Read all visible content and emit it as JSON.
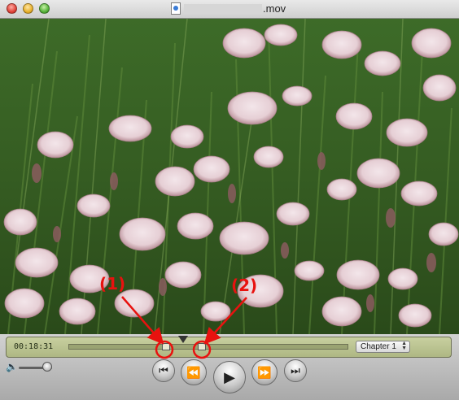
{
  "window": {
    "title": ".mov",
    "traffic_lights": {
      "close": "#e0443a",
      "minimize": "#e8b12c",
      "zoom": "#56b33a"
    }
  },
  "controller": {
    "timecode": "00:18:31",
    "chapter_label": "Chapter 1",
    "volume_level": 0.85
  },
  "icons": {
    "speaker": "🔈",
    "start": "⏮",
    "rewind": "⏪",
    "play": "▶",
    "fast_forward": "⏩",
    "end": "⏭"
  },
  "annotations": {
    "label_1": "(1)",
    "label_2": "(2)",
    "color": "#e8120f"
  }
}
